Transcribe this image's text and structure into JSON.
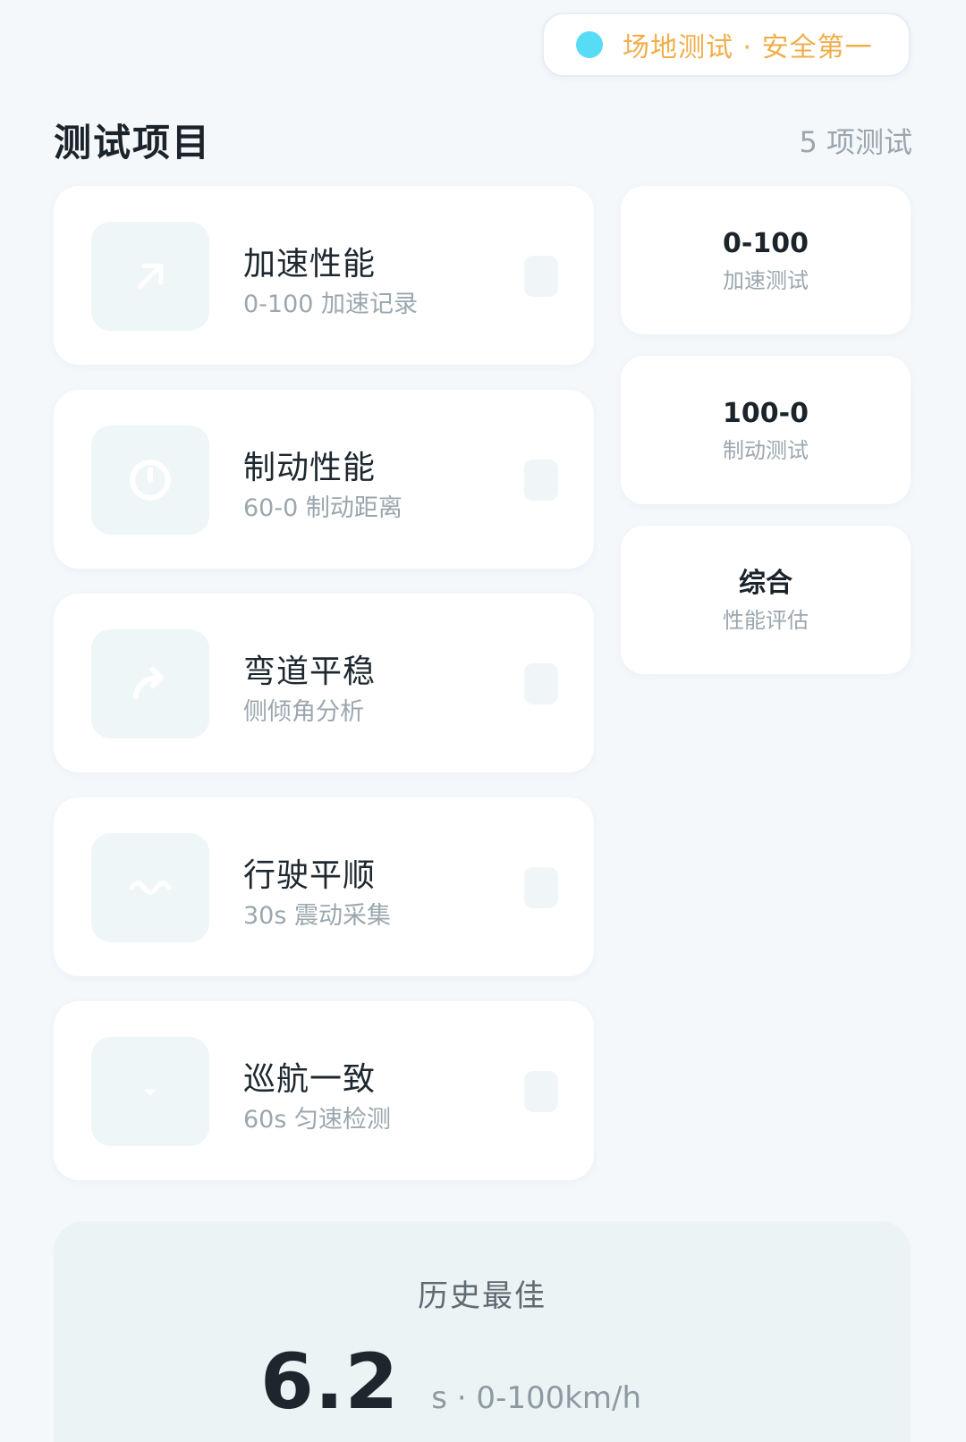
{
  "badge": {
    "text": "场地测试 · 安全第一",
    "dot_color": "#58dcf6",
    "text_color": "#f0ae4b"
  },
  "header": {
    "title": "测试项目",
    "count": "5 项测试"
  },
  "tests": [
    {
      "title": "加速性能",
      "subtitle": "0-100 加速记录",
      "icon": "arrow-up-right-icon"
    },
    {
      "title": "制动性能",
      "subtitle": "60-0 制动距离",
      "icon": "power-icon"
    },
    {
      "title": "弯道平稳",
      "subtitle": "侧倾角分析",
      "icon": "curve-arrow-icon"
    },
    {
      "title": "行驶平顺",
      "subtitle": "30s 震动采集",
      "icon": "wave-icon"
    },
    {
      "title": "巡航一致",
      "subtitle": "60s 匀速检测",
      "icon": "chevron-down-icon"
    }
  ],
  "summary": [
    {
      "main": "0-100",
      "sub": "加速测试"
    },
    {
      "main": "100-0",
      "sub": "制动测试"
    },
    {
      "main": "综合",
      "sub": "性能评估"
    }
  ],
  "best": {
    "label": "历史最佳",
    "value": "6.2",
    "unit": "s · 0-100km/h"
  }
}
